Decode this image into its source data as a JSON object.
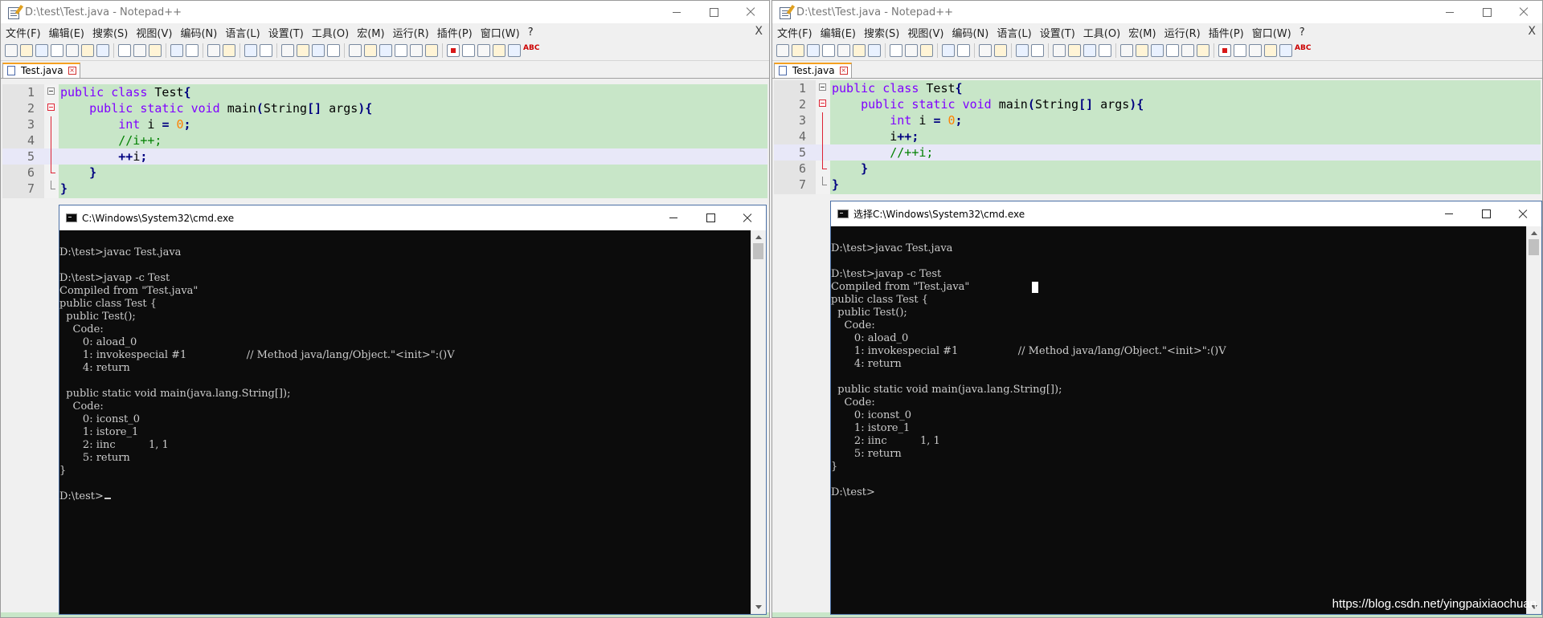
{
  "left": {
    "title": "D:\\test\\Test.java - Notepad++",
    "menus": [
      "文件(F)",
      "编辑(E)",
      "搜索(S)",
      "视图(V)",
      "编码(N)",
      "语言(L)",
      "设置(T)",
      "工具(O)",
      "宏(M)",
      "运行(R)",
      "插件(P)",
      "窗口(W)",
      "?"
    ],
    "doc_close": "X",
    "tab_label": "Test.java",
    "lines": [
      {
        "num": "1",
        "html": "<span class=\"kw\">public</span> <span class=\"kw\">class</span> Test<span class=\"op\">{</span>"
      },
      {
        "num": "2",
        "html": "    <span class=\"kw\">public</span> <span class=\"kw\">static</span> <span class=\"kw\">void</span> main<span class=\"op\">(</span>String<span class=\"op\">[]</span> args<span class=\"op\">){</span>"
      },
      {
        "num": "3",
        "html": "        <span class=\"ty\">int</span> i <span class=\"op\">=</span> <span class=\"num\">0</span><span class=\"op\">;</span>"
      },
      {
        "num": "4",
        "html": "        <span class=\"cm\">//i++;</span>"
      },
      {
        "num": "5",
        "html": "        <span class=\"op\">++</span>i<span class=\"op\">;</span>"
      },
      {
        "num": "6",
        "html": "    <span class=\"op\">}</span>"
      },
      {
        "num": "7",
        "html": "<span class=\"op\">}</span>"
      }
    ],
    "cmd_title": "C:\\Windows\\System32\\cmd.exe",
    "console": [
      "",
      "D:\\test>javac Test.java",
      "",
      "D:\\test>javap -c Test",
      "Compiled from \"Test.java\"",
      "public class Test {",
      "  public Test();",
      "    Code:",
      "       0: aload_0",
      "       1: invokespecial #1                  // Method java/lang/Object.\"<init>\":()V",
      "       4: return",
      "",
      "  public static void main(java.lang.String[]);",
      "    Code:",
      "       0: iconst_0",
      "       1: istore_1",
      "       2: iinc          1, 1",
      "       5: return",
      "}",
      "",
      "D:\\test>"
    ]
  },
  "right": {
    "title": "D:\\test\\Test.java - Notepad++",
    "menus": [
      "文件(F)",
      "编辑(E)",
      "搜索(S)",
      "视图(V)",
      "编码(N)",
      "语言(L)",
      "设置(T)",
      "工具(O)",
      "宏(M)",
      "运行(R)",
      "插件(P)",
      "窗口(W)",
      "?"
    ],
    "doc_close": "X",
    "tab_label": "Test.java",
    "lines": [
      {
        "num": "1",
        "html": "<span class=\"kw\">public</span> <span class=\"kw\">class</span> Test<span class=\"op\">{</span>"
      },
      {
        "num": "2",
        "html": "    <span class=\"kw\">public</span> <span class=\"kw\">static</span> <span class=\"kw\">void</span> main<span class=\"op\">(</span>String<span class=\"op\">[]</span> args<span class=\"op\">){</span>"
      },
      {
        "num": "3",
        "html": "        <span class=\"ty\">int</span> i <span class=\"op\">=</span> <span class=\"num\">0</span><span class=\"op\">;</span>"
      },
      {
        "num": "4",
        "html": "        i<span class=\"op\">++;</span>"
      },
      {
        "num": "5",
        "html": "        <span class=\"cm\">//++i;</span>"
      },
      {
        "num": "6",
        "html": "    <span class=\"op\">}</span>"
      },
      {
        "num": "7",
        "html": "<span class=\"op\">}</span>"
      }
    ],
    "cmd_title": "选择C:\\Windows\\System32\\cmd.exe",
    "console": [
      "",
      "D:\\test>javac Test.java",
      "",
      "D:\\test>javap -c Test",
      "Compiled from \"Test.java\"",
      "public class Test {",
      "  public Test();",
      "    Code:",
      "       0: aload_0",
      "       1: invokespecial #1                  // Method java/lang/Object.\"<init>\":()V",
      "       4: return",
      "",
      "  public static void main(java.lang.String[]);",
      "    Code:",
      "       0: iconst_0",
      "       1: istore_1",
      "       2: iinc          1, 1",
      "       5: return",
      "}",
      "",
      "D:\\test>"
    ]
  },
  "watermark": "https://blog.csdn.net/yingpaixiaochuan",
  "colors": {
    "editor_bg": "#c8e6c8",
    "current_line": "#e8e8f8",
    "keyword": "#8000ff",
    "number": "#ff8000",
    "comment": "#008000",
    "operator": "#000080",
    "console_bg": "#0c0c0c",
    "console_fg": "#cccccc",
    "tab_accent": "#f4a020"
  },
  "toolbar_icons": [
    "new-file-icon",
    "open-file-icon",
    "save-icon",
    "save-all-icon",
    "close-icon",
    "close-all-icon",
    "print-icon",
    "cut-icon",
    "copy-icon",
    "paste-icon",
    "undo-icon",
    "redo-icon",
    "find-icon",
    "replace-icon",
    "zoom-in-icon",
    "zoom-out-icon",
    "sync-v-icon",
    "sync-h-icon",
    "wrap-icon",
    "show-all-icon",
    "indent-guide-icon",
    "lang-icon",
    "doc-map-icon",
    "func-list-icon",
    "folder-icon",
    "monitor-icon",
    "record-icon",
    "stop-icon",
    "play-icon",
    "play-multi-icon",
    "save-macro-icon",
    "spellcheck-icon"
  ]
}
